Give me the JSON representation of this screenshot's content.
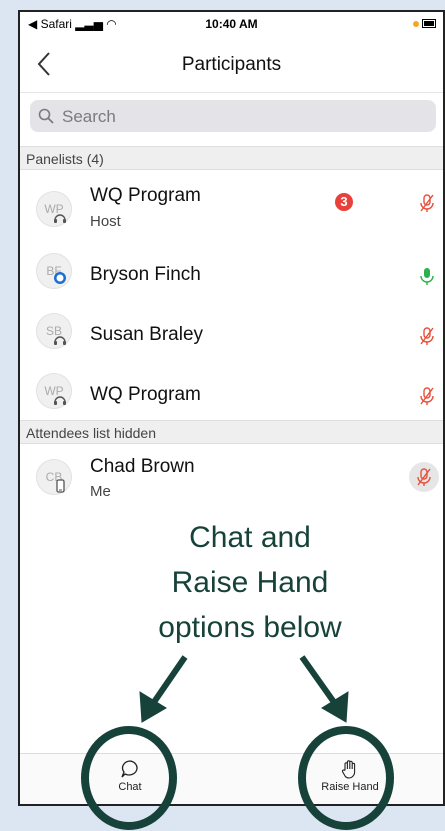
{
  "status": {
    "carrier": "◀ Safari",
    "time": "10:40 AM"
  },
  "nav": {
    "title": "Participants"
  },
  "search": {
    "placeholder": "Search"
  },
  "sections": {
    "panelists": "Panelists (4)",
    "attendees": "Attendees list hidden"
  },
  "participants": [
    {
      "initials": "WP",
      "name": "WQ Program",
      "role": "Host",
      "chat_count": "3",
      "mic": "muted"
    },
    {
      "initials": "BF",
      "name": "Bryson Finch",
      "role": "",
      "mic": "active"
    },
    {
      "initials": "SB",
      "name": "Susan Braley",
      "role": "",
      "mic": "muted"
    },
    {
      "initials": "WP",
      "name": "WQ Program",
      "role": "",
      "mic": "muted"
    }
  ],
  "me": {
    "initials": "CB",
    "name": "Chad Brown",
    "role": "Me",
    "mic": "muted"
  },
  "annotation": {
    "lines": [
      "Chat and",
      "Raise Hand",
      "options below"
    ]
  },
  "tabs": {
    "chat": "Chat",
    "raise_hand": "Raise Hand"
  },
  "colors": {
    "annotation": "#16423a",
    "muted_mic": "#e8503a",
    "active_mic": "#2bb24c",
    "badge": "#e8403a"
  }
}
